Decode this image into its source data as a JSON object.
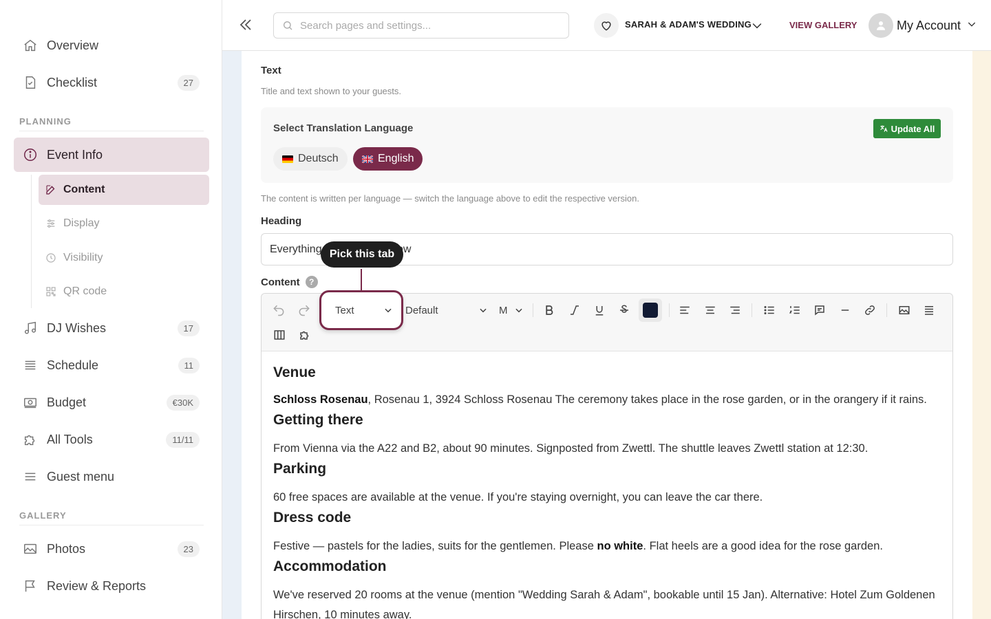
{
  "sidebar": {
    "items": [
      {
        "label": "Overview",
        "icon": "home-icon"
      },
      {
        "label": "Checklist",
        "icon": "checklist-icon",
        "count": "27"
      },
      {
        "label": "Event Info",
        "icon": "info-icon",
        "active": true
      },
      {
        "label": "DJ Wishes",
        "icon": "music-icon",
        "count": "17"
      },
      {
        "label": "Schedule",
        "icon": "schedule-icon",
        "count": "11"
      },
      {
        "label": "Budget",
        "icon": "budget-icon",
        "count": "€30K"
      },
      {
        "label": "All Tools",
        "icon": "puzzle-icon",
        "count": "11/11"
      },
      {
        "label": "Guest menu",
        "icon": "menu-icon"
      },
      {
        "label": "Photos",
        "icon": "photo-icon",
        "count": "23"
      },
      {
        "label": "Review & Reports",
        "icon": "flag-icon"
      }
    ],
    "sections": {
      "planning": "PLANNING",
      "gallery": "GALLERY"
    },
    "subitems": [
      {
        "label": "Content",
        "icon": "edit-icon",
        "active": true
      },
      {
        "label": "Display",
        "icon": "sliders-icon"
      },
      {
        "label": "Visibility",
        "icon": "clock-icon"
      },
      {
        "label": "QR code",
        "icon": "qr-icon"
      }
    ]
  },
  "header": {
    "search_placeholder": "Search pages and settings...",
    "event_name": "SARAH & ADAM'S WEDDING",
    "gallery_link": "VIEW GALLERY",
    "account_label": "My Account"
  },
  "main": {
    "title": "Text",
    "subtitle": "Title and text shown to your guests.",
    "language": {
      "title": "Select Translation Language",
      "update_button": "Update All",
      "options": [
        {
          "label": "Deutsch"
        },
        {
          "label": "English",
          "selected": true
        }
      ]
    },
    "hint": "The content is written per language — switch the language above to edit the respective version.",
    "heading_label": "Heading",
    "heading_value": "Everything you need to know",
    "content_label": "Content",
    "help_icon": "?",
    "editor": {
      "block_type": "Text",
      "font": "Default",
      "size": "M",
      "text_color": "#111a33",
      "body": {
        "venue_heading": "Venue",
        "venue_name": "Schloss Rosenau",
        "venue_text": ", Rosenau 1, 3924 Schloss Rosenau The ceremony takes place in the rose garden, or in the orangery if it rains.",
        "getting_heading": "Getting there",
        "getting_text": "From Vienna via the A22 and B2, about 90 minutes. Signposted from Zwettl. The shuttle leaves Zwettl station at 12:30.",
        "parking_heading": "Parking",
        "parking_text": "60 free spaces are available at the venue. If you're staying overnight, you can leave the car there.",
        "dress_heading": "Dress code",
        "dress_text_1": "Festive — pastels for the ladies, suits for the gentlemen. Please ",
        "dress_bold": "no white",
        "dress_text_2": ". Flat heels are a good idea for the rose garden.",
        "accom_heading": "Accommodation",
        "accom_text": "We've reserved 20 rooms at the venue (mention \"Wedding Sarah & Adam\", bookable until 15 Jan). Alternative: Hotel Zum Goldenen Hirschen, 10 minutes away."
      }
    }
  },
  "tooltip": "Pick this tab",
  "colors": {
    "accent": "#7a2a4a",
    "active_bg": "#eadde2",
    "success": "#2e8b3a"
  }
}
